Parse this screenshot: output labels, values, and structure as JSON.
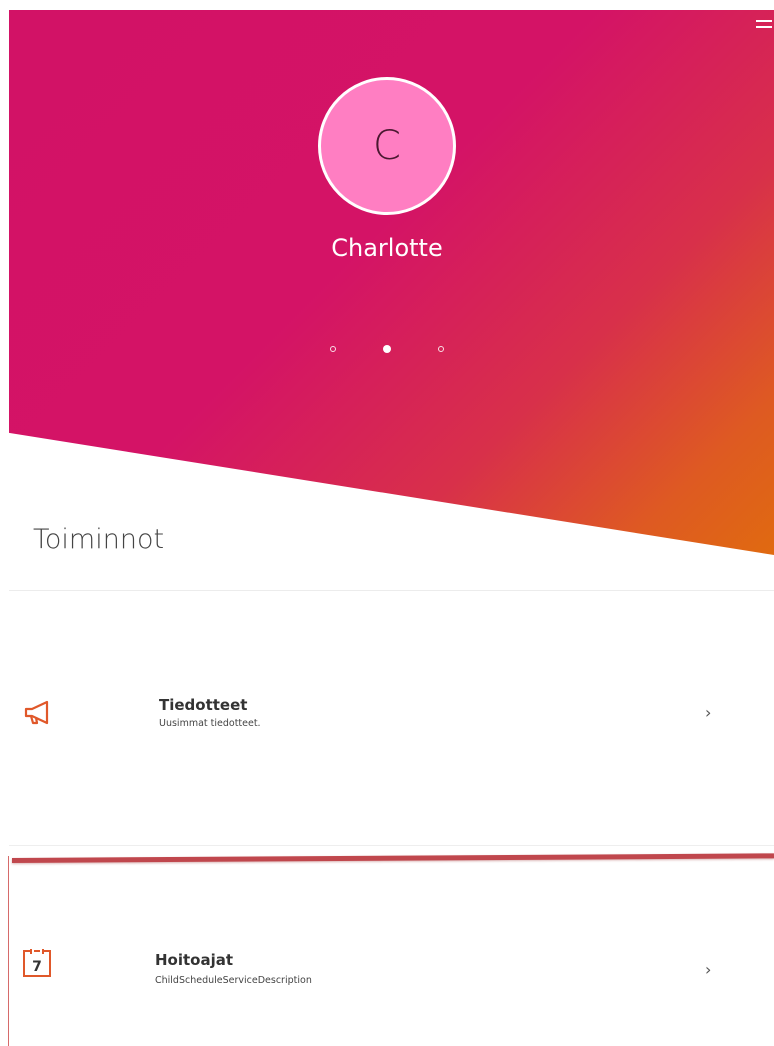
{
  "profile": {
    "initial": "C",
    "name": "Charlotte"
  },
  "pager": {
    "pages": 3,
    "active_index": 1
  },
  "section": {
    "title": "Toiminnot"
  },
  "items": [
    {
      "title": "Tiedotteet",
      "description": "Uusimmat tiedotteet.",
      "icon": "megaphone-icon"
    },
    {
      "title": "Hoitoajat",
      "description": "ChildScheduleServiceDescription",
      "icon": "calendar-icon",
      "icon_text": "7"
    }
  ],
  "colors": {
    "brand_pink": "#d21266",
    "brand_orange": "#e06a10",
    "avatar_fill": "#ff7ec2",
    "icon_orange": "#e0582a"
  }
}
